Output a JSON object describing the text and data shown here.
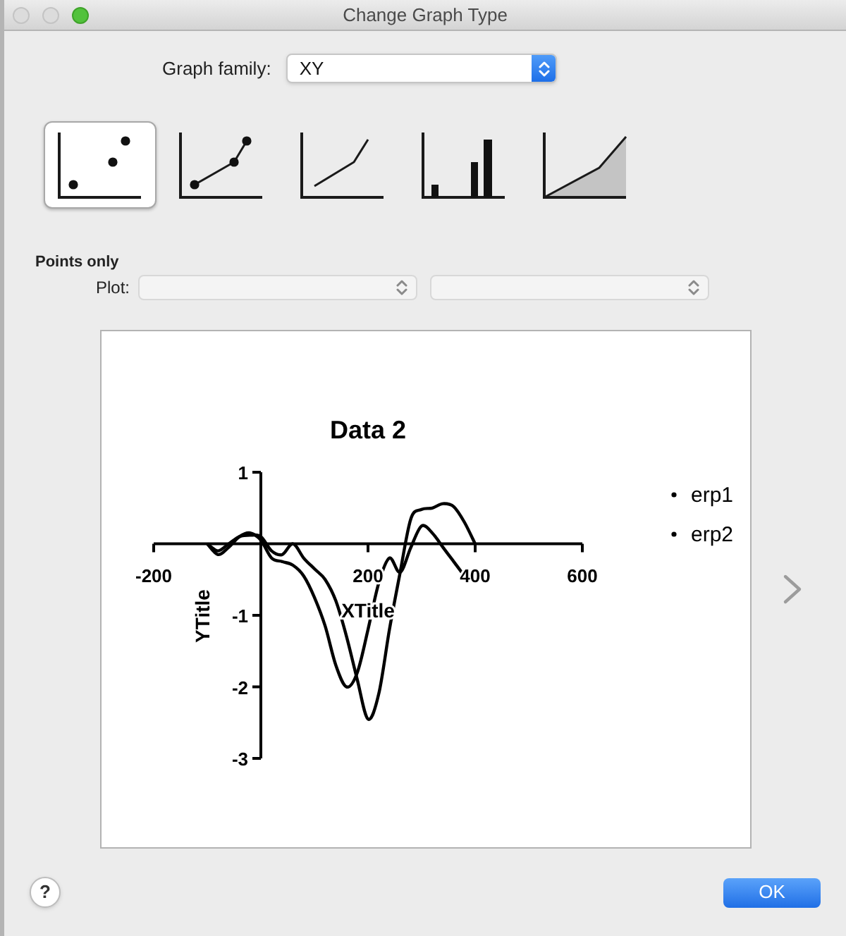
{
  "window": {
    "title": "Change Graph Type"
  },
  "graph_family": {
    "label": "Graph family:",
    "value": "XY"
  },
  "graph_types": [
    {
      "kind": "points",
      "selected": true
    },
    {
      "kind": "points_line",
      "selected": false
    },
    {
      "kind": "line",
      "selected": false
    },
    {
      "kind": "bar",
      "selected": false
    },
    {
      "kind": "area",
      "selected": false
    }
  ],
  "subtype": {
    "title": "Points only",
    "plot_label": "Plot:",
    "plot_selects": [
      {
        "disabled": true
      },
      {
        "disabled": true
      }
    ]
  },
  "preview": {
    "chart_data": {
      "type": "line",
      "title": "Data 2",
      "xlabel": "XTitle",
      "ylabel": "YTitle",
      "x": [
        -100,
        -80,
        -60,
        -40,
        -20,
        0,
        20,
        40,
        60,
        80,
        100,
        120,
        140,
        160,
        180,
        200,
        220,
        240,
        260,
        280,
        300,
        320,
        340,
        360,
        380,
        400
      ],
      "series": [
        {
          "name": "erp1",
          "color": "#000000",
          "values": [
            0,
            -0.15,
            -0.05,
            0.1,
            0.15,
            0.05,
            -0.2,
            -0.25,
            -0.3,
            -0.45,
            -0.75,
            -1.15,
            -1.7,
            -2.0,
            -1.8,
            -1.2,
            -0.55,
            -0.2,
            -0.4,
            -0.05,
            0.25,
            0.15,
            -0.05,
            -0.25,
            -0.45,
            null
          ]
        },
        {
          "name": "erp2",
          "color": "#000000",
          "values": [
            0,
            -0.1,
            0,
            0.1,
            0.12,
            0.1,
            -0.1,
            -0.15,
            0,
            -0.2,
            -0.35,
            -0.5,
            -0.8,
            -1.3,
            -1.9,
            -2.45,
            -2.1,
            -1.2,
            -0.4,
            0.35,
            0.48,
            0.5,
            0.56,
            0.52,
            0.3,
            0
          ]
        }
      ],
      "legend": "right",
      "xlim": [
        -200,
        600
      ],
      "ylim": [
        -3,
        1
      ],
      "xticks": [
        -200,
        200,
        400,
        600
      ],
      "yticks": [
        1,
        -1,
        -2,
        -3
      ]
    }
  },
  "footer": {
    "help_label": "?",
    "ok_label": "OK"
  }
}
